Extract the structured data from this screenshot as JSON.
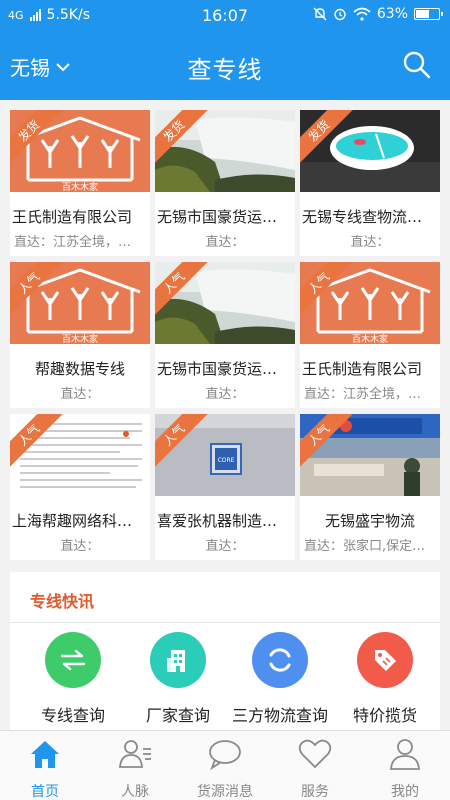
{
  "status": {
    "network": "4G",
    "speed": "5.5K/s",
    "time": "16:07",
    "battery": "63%",
    "battery_level": 0.63
  },
  "header": {
    "city": "无锡",
    "title": "查专线"
  },
  "cards": [
    {
      "badge": "发货",
      "name": "王氏制造有限公司",
      "dest": "直达：江苏全境，…",
      "image": "house-logo"
    },
    {
      "badge": "发货",
      "name": "无锡市国豪货运…",
      "dest": "直达：",
      "image": "waterfall"
    },
    {
      "badge": "发货",
      "name": "无锡专线查物流…",
      "dest": "直达：",
      "image": "mouse"
    },
    {
      "badge": "人气",
      "name": "帮趣数据专线",
      "dest": "直达：",
      "image": "house-logo"
    },
    {
      "badge": "人气",
      "name": "无锡市国豪货运…",
      "dest": "直达：",
      "image": "waterfall"
    },
    {
      "badge": "人气",
      "name": "王氏制造有限公司",
      "dest": "直达：江苏全境，…",
      "image": "house-logo"
    },
    {
      "badge": "人气",
      "name": "上海帮趣网络科…",
      "dest": "直达：",
      "image": "document"
    },
    {
      "badge": "人气",
      "name": "喜爱张机器制造…",
      "dest": "直达：",
      "image": "intel-chip"
    },
    {
      "badge": "人气",
      "name": "无锡盛宇物流",
      "dest": "直达：张家口,保定…",
      "image": "office"
    }
  ],
  "house_logo_text": "百木木家",
  "news": {
    "title": "专线快讯",
    "quick_links": [
      {
        "label": "专线查询",
        "icon": "swap-arrows-icon",
        "color": "#3ecb6a"
      },
      {
        "label": "厂家查询",
        "icon": "building-icon",
        "color": "#2ccdb8"
      },
      {
        "label": "三方物流查询",
        "icon": "refresh-icon",
        "color": "#4e8ff0"
      },
      {
        "label": "特价揽货",
        "icon": "tag-icon",
        "color": "#f25a4a"
      }
    ]
  },
  "tabs": [
    {
      "label": "首页",
      "icon": "home-icon",
      "active": true
    },
    {
      "label": "人脉",
      "icon": "contacts-icon",
      "active": false
    },
    {
      "label": "货源消息",
      "icon": "message-icon",
      "active": false
    },
    {
      "label": "服务",
      "icon": "heart-icon",
      "active": false
    },
    {
      "label": "我的",
      "icon": "user-icon",
      "active": false
    }
  ],
  "colors": {
    "primary": "#1f95ee",
    "accent": "#e9743f",
    "news_title": "#e05a2b"
  }
}
